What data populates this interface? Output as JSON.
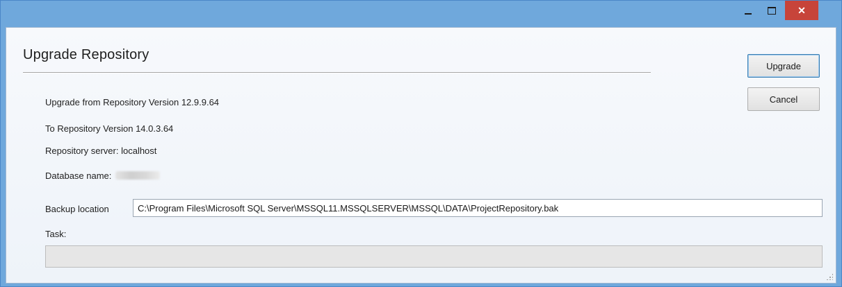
{
  "window": {
    "controls": {
      "minimize_icon": "minimize-icon",
      "maximize_icon": "maximize-icon",
      "close_glyph": "✕"
    },
    "colors": {
      "title_bar": "#6fa8dc",
      "close_button": "#c7443a"
    }
  },
  "dialog": {
    "title": "Upgrade Repository",
    "info": {
      "upgrade_from": "Upgrade from Repository Version 12.9.9.64",
      "to_version": "To Repository Version 14.0.3.64",
      "server": "Repository server: localhost",
      "database_label": "Database name:"
    },
    "buttons": {
      "upgrade": "Upgrade",
      "cancel": "Cancel"
    },
    "backup": {
      "label": "Backup location",
      "value": "C:\\Program Files\\Microsoft SQL Server\\MSSQL11.MSSQLSERVER\\MSSQL\\DATA\\ProjectRepository.bak"
    },
    "task": {
      "label": "Task:",
      "progress": 0
    }
  }
}
